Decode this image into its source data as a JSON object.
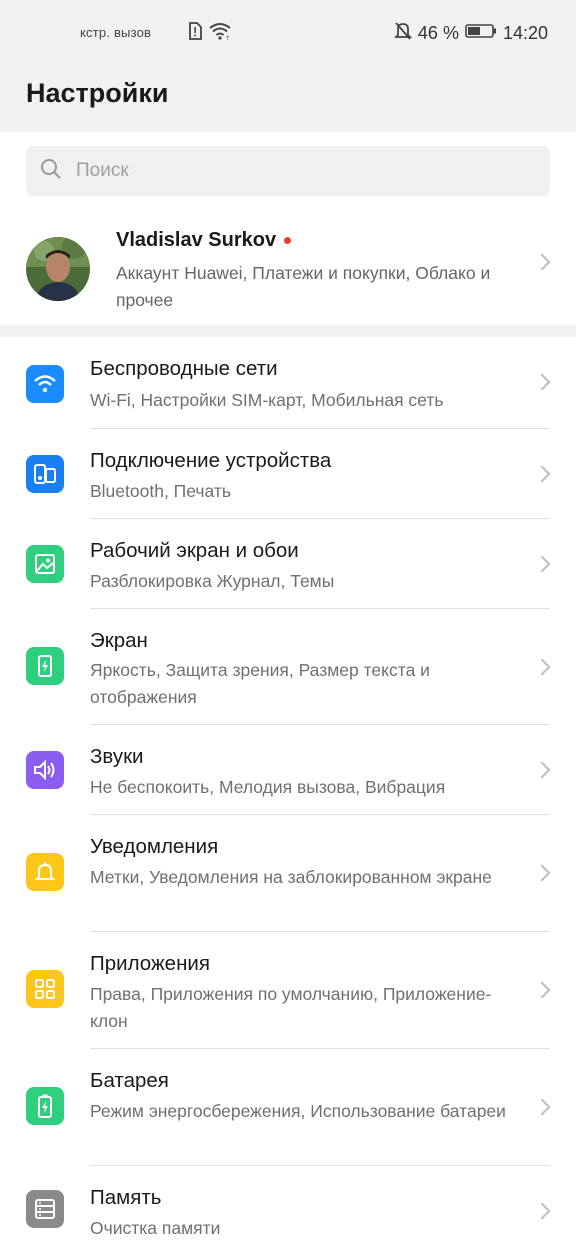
{
  "status_bar": {
    "carrier_text": "кстр. вызов",
    "battery_percent": "46 %",
    "time": "14:20"
  },
  "page_title": "Настройки",
  "search": {
    "placeholder": "Поиск"
  },
  "account": {
    "name": "Vladislav Surkov",
    "subtitle": "Аккаунт Huawei, Платежи и покупки, Облако и прочее"
  },
  "items": [
    {
      "title": "Беспроводные сети",
      "subtitle": "Wi-Fi, Настройки SIM-карт, Мобильная сеть",
      "icon": "wifi-icon",
      "color": "#1a8cff"
    },
    {
      "title": "Подключение устройства",
      "subtitle": "Bluetooth, Печать",
      "icon": "device-connection-icon",
      "color": "#1a7ff0"
    },
    {
      "title": "Рабочий экран и обои",
      "subtitle": "Разблокировка Журнал, Темы",
      "icon": "wallpaper-icon",
      "color": "#2fcf7f"
    },
    {
      "title": "Экран",
      "subtitle": "Яркость, Защита зрения, Размер текста и отображения",
      "icon": "display-icon",
      "color": "#2fcf7f"
    },
    {
      "title": "Звуки",
      "subtitle": "Не беспокоить, Мелодия вызова, Вибрация",
      "icon": "sound-icon",
      "color": "#8a5cf0"
    },
    {
      "title": "Уведомления",
      "subtitle": "Метки, Уведомления на заблокированном экране",
      "icon": "bell-icon",
      "color": "#ffc61a"
    },
    {
      "title": "Приложения",
      "subtitle": "Права, Приложения по умолчанию, Приложение-клон",
      "icon": "apps-icon",
      "color": "#ffc61a"
    },
    {
      "title": "Батарея",
      "subtitle": "Режим энергосбережения, Использование батареи",
      "icon": "battery-icon",
      "color": "#2fcf7f"
    },
    {
      "title": "Память",
      "subtitle": "Очистка памяти",
      "icon": "storage-icon",
      "color": "#8a8a8a"
    }
  ]
}
